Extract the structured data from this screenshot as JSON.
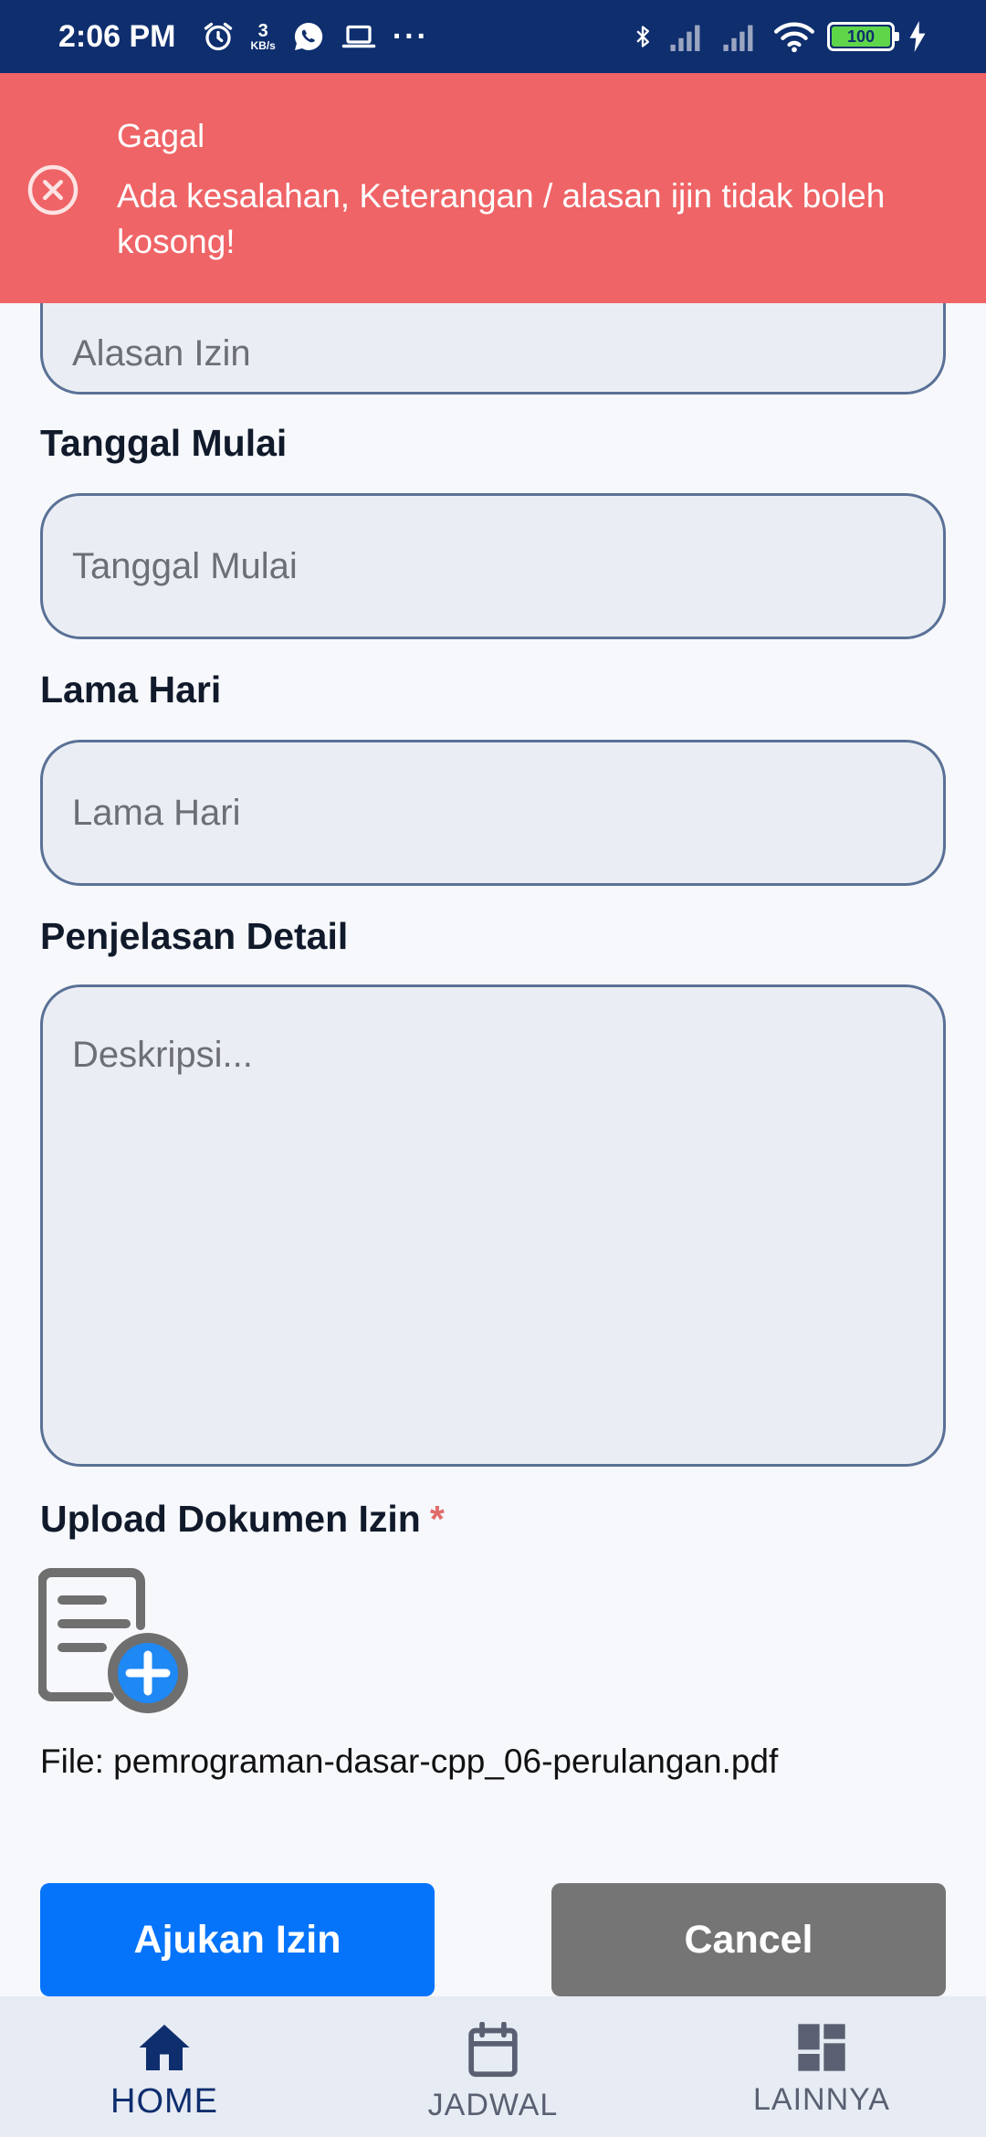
{
  "status_bar": {
    "time": "2:06 PM",
    "net_speed_value": "3",
    "net_speed_unit": "KB/s",
    "more": "···",
    "battery": "100",
    "icons": [
      "alarm-icon",
      "whatsapp-icon",
      "laptop-icon",
      "bluetooth-icon",
      "signal-icon",
      "signal-icon",
      "wifi-icon",
      "battery-icon",
      "charging-icon"
    ]
  },
  "toast": {
    "title": "Gagal",
    "message": "Ada kesalahan, Keterangan / alasan ijin tidak boleh kosong!",
    "icon": "error-circle-icon",
    "color": "#ef6466"
  },
  "form": {
    "alasan": {
      "placeholder": "Alasan Izin"
    },
    "tanggal_mulai": {
      "label": "Tanggal Mulai",
      "placeholder": "Tanggal Mulai"
    },
    "lama_hari": {
      "label": "Lama Hari",
      "placeholder": "Lama Hari"
    },
    "penjelasan": {
      "label": "Penjelasan Detail",
      "placeholder": "Deskripsi..."
    },
    "upload": {
      "label": "Upload Dokumen Izin",
      "required_mark": "*",
      "file_text": "File: pemrograman-dasar-cpp_06-perulangan.pdf"
    }
  },
  "buttons": {
    "submit": "Ajukan Izin",
    "cancel": "Cancel"
  },
  "bottom_nav": {
    "items": [
      {
        "label": "HOME",
        "icon": "home-icon",
        "active": true
      },
      {
        "label": "JADWAL",
        "icon": "calendar-icon",
        "active": false
      },
      {
        "label": "LAINNYA",
        "icon": "dashboard-icon",
        "active": false
      }
    ]
  },
  "colors": {
    "status_bar": "#0e2e6e",
    "primary": "#0574fb",
    "cancel": "#757575",
    "field_border": "#5a7196"
  }
}
